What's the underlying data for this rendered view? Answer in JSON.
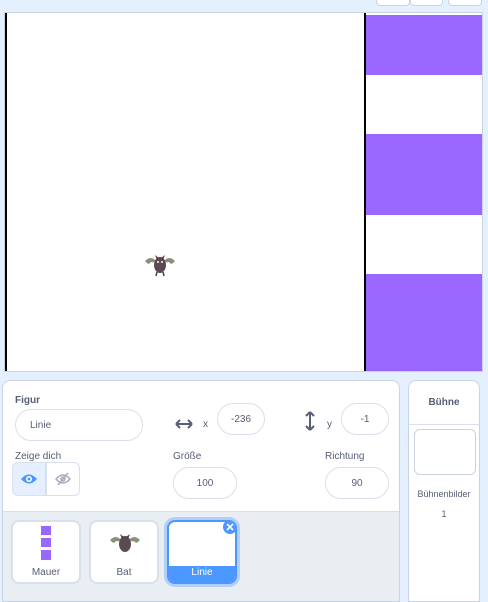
{
  "stage": {
    "colors": {
      "wall": "#9966ff",
      "line": "#000000",
      "background": "#ffffff"
    }
  },
  "sprite_info": {
    "sprite_label": "Figur",
    "sprite_name": "Linie",
    "x_label": "x",
    "x_value": "-236",
    "y_label": "y",
    "y_value": "-1",
    "show_label": "Zeige dich",
    "size_label": "Größe",
    "size_value": "100",
    "direction_label": "Richtung",
    "direction_value": "90"
  },
  "sprites": [
    {
      "name": "Mauer",
      "selected": false
    },
    {
      "name": "Bat",
      "selected": false
    },
    {
      "name": "Linie",
      "selected": true
    }
  ],
  "stage_panel": {
    "title": "Bühne",
    "backdrops_label": "Bühnenbilder",
    "backdrops_count": "1"
  },
  "accent_color": "#4c97ff"
}
